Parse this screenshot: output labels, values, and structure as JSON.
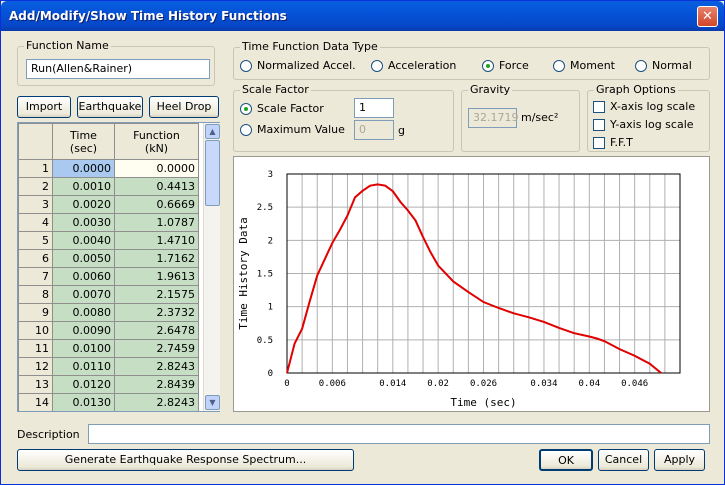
{
  "window": {
    "title": "Add/Modify/Show Time History Functions",
    "close": "✕"
  },
  "function_name": {
    "label": "Function Name",
    "value": "Run(Allen&Rainer)"
  },
  "data_type": {
    "label": "Time Function Data Type",
    "options": [
      "Normalized Accel.",
      "Acceleration",
      "Force",
      "Moment",
      "Normal"
    ],
    "selected": "Force"
  },
  "buttons": {
    "import": "Import",
    "earthquake": "Earthquake",
    "heel_drop": "Heel Drop",
    "generate": "Generate Earthquake Response Spectrum...",
    "ok": "OK",
    "cancel": "Cancel",
    "apply": "Apply"
  },
  "scale": {
    "label": "Scale Factor",
    "scale_factor_label": "Scale Factor",
    "scale_factor_value": "1",
    "max_value_label": "Maximum Value",
    "max_value_value": "0",
    "max_unit": "g",
    "selected": "Scale Factor"
  },
  "gravity": {
    "label": "Gravity",
    "value": "32.1719",
    "unit": "m/sec²"
  },
  "graph_options": {
    "label": "Graph Options",
    "x_log": "X-axis log scale",
    "y_log": "Y-axis log scale",
    "fft": "F.F.T"
  },
  "table": {
    "headers": {
      "time": "Time\n(sec)",
      "function": "Function\n(kN)"
    },
    "rows": [
      [
        "1",
        "0.0000",
        "0.0000"
      ],
      [
        "2",
        "0.0010",
        "0.4413"
      ],
      [
        "3",
        "0.0020",
        "0.6669"
      ],
      [
        "4",
        "0.0030",
        "1.0787"
      ],
      [
        "5",
        "0.0040",
        "1.4710"
      ],
      [
        "6",
        "0.0050",
        "1.7162"
      ],
      [
        "7",
        "0.0060",
        "1.9613"
      ],
      [
        "8",
        "0.0070",
        "2.1575"
      ],
      [
        "9",
        "0.0080",
        "2.3732"
      ],
      [
        "10",
        "0.0090",
        "2.6478"
      ],
      [
        "11",
        "0.0100",
        "2.7459"
      ],
      [
        "12",
        "0.0110",
        "2.8243"
      ],
      [
        "13",
        "0.0120",
        "2.8439"
      ],
      [
        "14",
        "0.0130",
        "2.8243"
      ]
    ]
  },
  "description": {
    "label": "Description",
    "value": ""
  },
  "chart_data": {
    "type": "line",
    "xlabel": "Time (sec)",
    "ylabel": "Time History Data",
    "xlim": [
      0,
      0.052
    ],
    "ylim": [
      0,
      3
    ],
    "x_ticks": [
      "0",
      "0.006",
      "0.014",
      "0.02",
      "0.026",
      "0.034",
      "0.04",
      "0.046"
    ],
    "x_tick_values": [
      0,
      0.006,
      0.014,
      0.02,
      0.026,
      0.034,
      0.04,
      0.046
    ],
    "y_ticks": [
      "0",
      "0.5",
      "1",
      "1.5",
      "2",
      "2.5",
      "3"
    ],
    "y_tick_values": [
      0,
      0.5,
      1,
      1.5,
      2,
      2.5,
      3
    ],
    "grid": true,
    "color": "#e00000",
    "series": [
      {
        "x": [
          0,
          0.001,
          0.002,
          0.003,
          0.004,
          0.005,
          0.006,
          0.007,
          0.008,
          0.009,
          0.01,
          0.011,
          0.012,
          0.013,
          0.014,
          0.015,
          0.016,
          0.017,
          0.018,
          0.019,
          0.02,
          0.022,
          0.024,
          0.026,
          0.028,
          0.03,
          0.032,
          0.034,
          0.036,
          0.038,
          0.04,
          0.041,
          0.042,
          0.044,
          0.046,
          0.048,
          0.0495
        ],
        "y": [
          0,
          0.4413,
          0.6669,
          1.0787,
          1.471,
          1.7162,
          1.9613,
          2.1575,
          2.3732,
          2.6478,
          2.7459,
          2.8243,
          2.8439,
          2.8243,
          2.74,
          2.58,
          2.45,
          2.3,
          2.05,
          1.82,
          1.62,
          1.38,
          1.22,
          1.07,
          0.98,
          0.9,
          0.84,
          0.77,
          0.68,
          0.6,
          0.55,
          0.52,
          0.48,
          0.36,
          0.26,
          0.14,
          0.0
        ]
      }
    ]
  }
}
